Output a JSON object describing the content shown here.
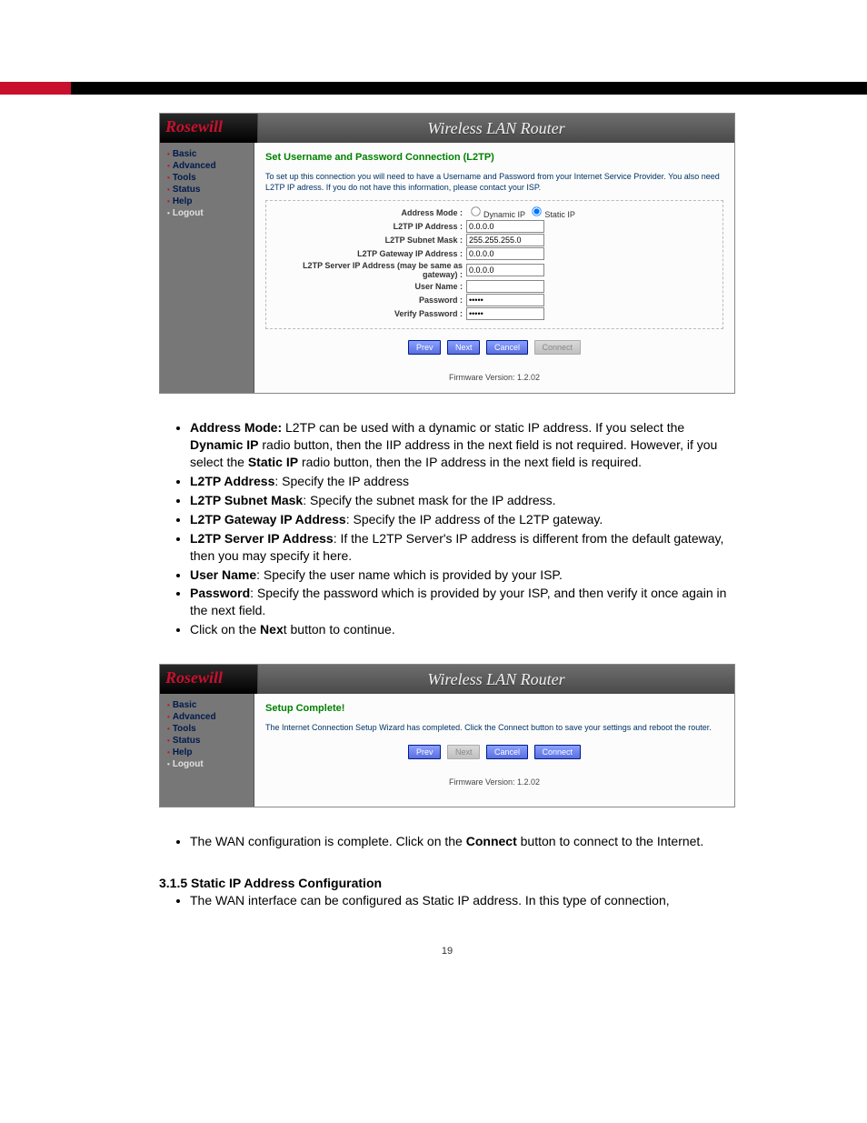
{
  "topbar": {},
  "shot1": {
    "logo": "Rosewill",
    "title": "Wireless LAN Router",
    "sidebar": [
      "Basic",
      "Advanced",
      "Tools",
      "Status",
      "Help",
      "Logout"
    ],
    "section_title": "Set Username and Password Connection (L2TP)",
    "desc": "To set up this connection you will need to have a Username and Password from your Internet Service Provider. You also need L2TP IP adress. If you do not have this information, please contact your ISP.",
    "rows": {
      "address_mode_label": "Address Mode :",
      "dynamic_ip": "Dynamic IP",
      "static_ip": "Static IP",
      "l2tp_ip_label": "L2TP IP Address :",
      "l2tp_ip_value": "0.0.0.0",
      "subnet_label": "L2TP Subnet Mask :",
      "subnet_value": "255.255.255.0",
      "gateway_label": "L2TP Gateway IP Address :",
      "gateway_value": "0.0.0.0",
      "server_label": "L2TP Server IP Address (may be same as gateway) :",
      "server_value": "0.0.0.0",
      "user_label": "User Name :",
      "user_value": "",
      "pw_label": "Password :",
      "pw_value": "•••••",
      "vpw_label": "Verify Password :",
      "vpw_value": "•••••"
    },
    "buttons": {
      "prev": "Prev",
      "next": "Next",
      "cancel": "Cancel",
      "connect": "Connect"
    },
    "firmware": "Firmware Version: 1.2.02"
  },
  "doc_list1": {
    "i1a": "Address Mode:",
    "i1b": " L2TP can be used with a dynamic or static IP address. If you select the ",
    "i1c": "Dynamic IP",
    "i1d": " radio button, then the IIP address in the next field is not required. However, if you select the ",
    "i1e": "Static IP",
    "i1f": " radio button, then the IP address in the next field is required.",
    "i2a": "L2TP Address",
    "i2b": ": Specify the IP address",
    "i3a": "L2TP Subnet Mask",
    "i3b": ": Specify the subnet mask for the IP address.",
    "i4a": "L2TP Gateway IP Address",
    "i4b": ": Specify the IP address of the L2TP gateway.",
    "i5a": "L2TP Server IP Address",
    "i5b": ": If the L2TP Server's IP address is different from the default gateway, then you may specify it here.",
    "i6a": "User Name",
    "i6b": ": Specify the user name which is provided by your ISP.",
    "i7a": "Password",
    "i7b": ": Specify the password which is provided by your ISP, and then verify it once again in the next field.",
    "i8a": "Click on the ",
    "i8b": "Nex",
    "i8c": "t button to continue."
  },
  "shot2": {
    "logo": "Rosewill",
    "title": "Wireless LAN Router",
    "sidebar": [
      "Basic",
      "Advanced",
      "Tools",
      "Status",
      "Help",
      "Logout"
    ],
    "section_title": "Setup Complete!",
    "desc": "The Internet Connection Setup Wizard has completed. Click the Connect button to save your settings and reboot the router.",
    "buttons": {
      "prev": "Prev",
      "next": "Next",
      "cancel": "Cancel",
      "connect": "Connect"
    },
    "firmware": "Firmware Version: 1.2.02"
  },
  "doc_list2": {
    "i1a": "The WAN configuration is complete. Click on the ",
    "i1b": "Connect",
    "i1c": " button to connect to the Internet."
  },
  "section315": {
    "heading": "3.1.5  Static IP Address Configuration",
    "bullet": "The WAN interface can be configured as Static IP address. In this type of connection,"
  },
  "page_num": "19"
}
